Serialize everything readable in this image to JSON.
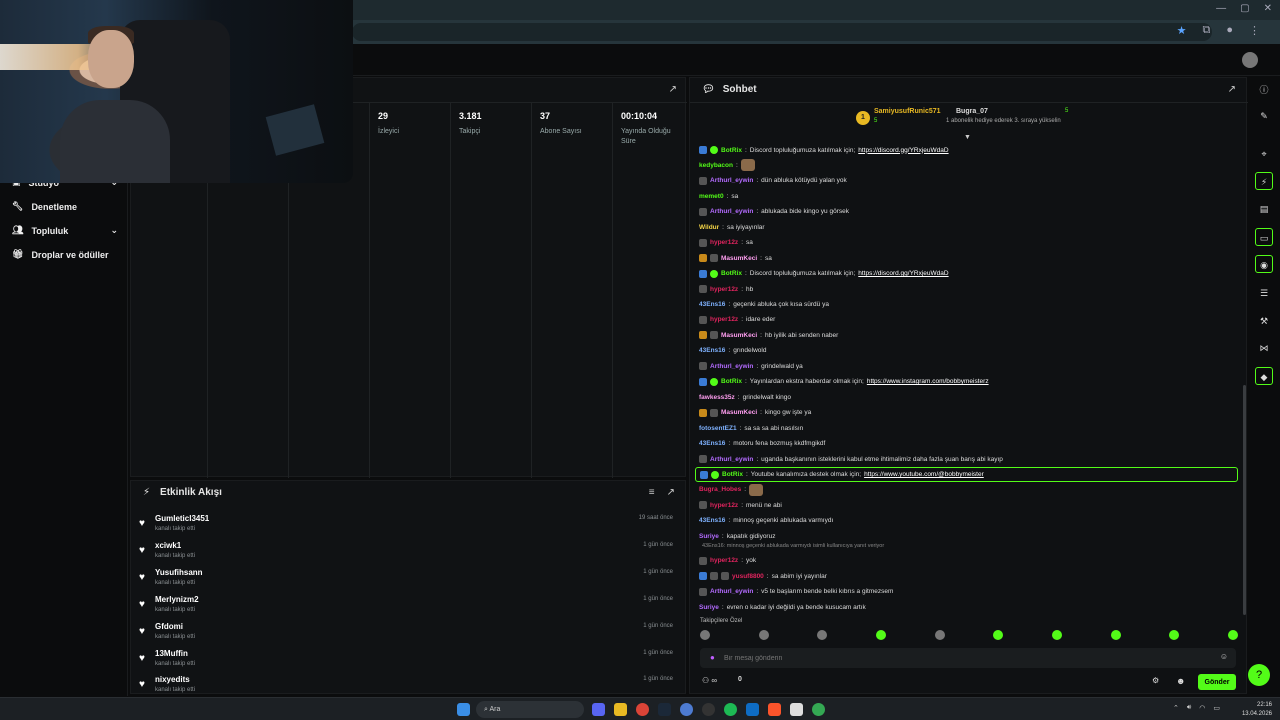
{
  "sidebar": {
    "items": [
      {
        "label": "Stüdyo",
        "icon": "studio-icon"
      },
      {
        "label": "Denetleme",
        "icon": "wrench-icon"
      },
      {
        "label": "Topluluk",
        "icon": "people-icon"
      },
      {
        "label": "Droplar ve ödüller",
        "icon": "gift-icon"
      }
    ]
  },
  "stats": [
    {
      "value": "29",
      "label": "İzleyici"
    },
    {
      "value": "3.181",
      "label": "Takipçi"
    },
    {
      "value": "37",
      "label": "Abone Sayısı"
    },
    {
      "value": "00:10:04",
      "label": "Yayında Olduğu Süre"
    }
  ],
  "feed": {
    "title": "Etkinlik Akışı",
    "items": [
      {
        "name": "Gumleticl3451",
        "sub": "kanalı takip etti",
        "time": "19 saat önce"
      },
      {
        "name": "xciwk1",
        "sub": "kanalı takip etti",
        "time": "1 gün önce"
      },
      {
        "name": "Yusufihsann",
        "sub": "kanalı takip etti",
        "time": "1 gün önce"
      },
      {
        "name": "Merlynizm2",
        "sub": "kanalı takip etti",
        "time": "1 gün önce"
      },
      {
        "name": "Gfdomi",
        "sub": "kanalı takip etti",
        "time": "1 gün önce"
      },
      {
        "name": "13Muffin",
        "sub": "kanalı takip etti",
        "time": "1 gün önce"
      },
      {
        "name": "nixyedits",
        "sub": "kanalı takip etti",
        "time": "1 gün önce"
      }
    ]
  },
  "chat": {
    "title": "Sohbet",
    "gifter1": {
      "rank": "1",
      "name": "SamiyusufRunic571",
      "count": "5"
    },
    "gifter2": {
      "name": "Bugra_07",
      "count": "5",
      "note": "1 abonelik hediye ederek 3. sıraya yükselin"
    },
    "messages": [
      {
        "user": "BotRix",
        "color": "#53fc18",
        "badges": [
          "bot",
          "ver"
        ],
        "text": "Discord topluluğumuza katılmak için;",
        "link": "https://discord.gg/YRxjeuWdaD"
      },
      {
        "user": "kedybacon",
        "color": "#53fc18",
        "badges": [],
        "sticker": true,
        "text": ""
      },
      {
        "user": "Arthurl_eywin",
        "color": "#b36bff",
        "badges": [
          "sub"
        ],
        "text": "dün abluka kötüydü yalan yok"
      },
      {
        "user": "memet0",
        "color": "#53fc18",
        "badges": [],
        "text": "sa"
      },
      {
        "user": "Arthurl_eywin",
        "color": "#b36bff",
        "badges": [
          "sub"
        ],
        "text": "ablukada bide kingo yu görsek"
      },
      {
        "user": "Wildur",
        "color": "#f5d547",
        "badges": [],
        "text": "sa iyiyayınlar"
      },
      {
        "user": "hyper12z",
        "color": "#e0245e",
        "badges": [
          "sub"
        ],
        "text": "sa"
      },
      {
        "user": "MasumKeci",
        "color": "#ff9ef0",
        "badges": [
          "crown",
          "sub"
        ],
        "text": "sa"
      },
      {
        "user": "BotRix",
        "color": "#53fc18",
        "badges": [
          "bot",
          "ver"
        ],
        "text": "Discord topluluğumuza katılmak için;",
        "link": "https://discord.gg/YRxjeuWdaD"
      },
      {
        "user": "hyper12z",
        "color": "#e0245e",
        "badges": [
          "sub"
        ],
        "text": "hb"
      },
      {
        "user": "43Ens16",
        "color": "#7fb2ff",
        "badges": [],
        "text": "geçenki abluka çok kısa sürdü ya"
      },
      {
        "user": "hyper12z",
        "color": "#e0245e",
        "badges": [
          "sub"
        ],
        "text": "idare eder"
      },
      {
        "user": "MasumKeci",
        "color": "#ff9ef0",
        "badges": [
          "crown",
          "sub"
        ],
        "text": "hb iyilik abi senden naber"
      },
      {
        "user": "43Ens16",
        "color": "#7fb2ff",
        "badges": [],
        "text": "grındelwold"
      },
      {
        "user": "Arthurl_eywin",
        "color": "#b36bff",
        "badges": [
          "sub"
        ],
        "text": "grindelwald ya"
      },
      {
        "user": "BotRix",
        "color": "#53fc18",
        "badges": [
          "bot",
          "ver"
        ],
        "text": "Yayınlardan ekstra haberdar olmak için;",
        "link": "https://www.instagram.com/bobbymeisterz"
      },
      {
        "user": "fawkess35z",
        "color": "#ff9ef0",
        "badges": [],
        "text": "grindelwalt kingo"
      },
      {
        "user": "MasumKeci",
        "color": "#ff9ef0",
        "badges": [
          "crown",
          "sub"
        ],
        "text": "kingo gw işte ya"
      },
      {
        "user": "fotosentEZ1",
        "color": "#7fb2ff",
        "badges": [],
        "text": "sa sa sa abi nasılsın"
      },
      {
        "user": "43Ens16",
        "color": "#7fb2ff",
        "badges": [],
        "text": "motoru fena bozmuş kkdfmgikdf"
      },
      {
        "user": "Arthurl_eywin",
        "color": "#b36bff",
        "badges": [
          "sub"
        ],
        "text": "uganda başkanının isteklerini kabul etme ihtimalimiz daha fazla şuan barış abi kayıp"
      },
      {
        "user": "BotRix",
        "color": "#53fc18",
        "badges": [
          "bot",
          "ver"
        ],
        "text": "Youtube kanalımıza destek olmak için;",
        "link": "https://www.youtube.com/@bobbymeister",
        "highlight": true
      },
      {
        "user": "Bugra_Hobes",
        "color": "#e0245e",
        "badges": [],
        "sticker": true,
        "text": ""
      },
      {
        "user": "hyper12z",
        "color": "#e0245e",
        "badges": [
          "sub"
        ],
        "text": "menü ne abi"
      },
      {
        "user": "43Ens16",
        "color": "#7fb2ff",
        "badges": [],
        "text": "minnoş geçenki ablukada varmıydı"
      },
      {
        "user": "Suriye",
        "color": "#b36bff",
        "badges": [],
        "text": "kapatık gidiyoruz"
      },
      {
        "user": "hyper12z",
        "color": "#e0245e",
        "badges": [
          "sub"
        ],
        "text": "yok",
        "reply": "43Ens16: minnoş geçenki ablukada varmıydı isimli kullanıcıya yanıt veriyor"
      },
      {
        "user": "yusuf8800",
        "color": "#e0245e",
        "badges": [
          "bot",
          "sub",
          "sub"
        ],
        "text": "sa abim iyi yayınlar"
      },
      {
        "user": "Arthurl_eywin",
        "color": "#b36bff",
        "badges": [
          "sub"
        ],
        "text": "v5 te başlarım bende belki kıbrıs a gitmezsem"
      },
      {
        "user": "Suriye",
        "color": "#b36bff",
        "badges": [],
        "text": "evren o kadar iyi değildi ya bende kusucam artık"
      }
    ],
    "emote_label": "Takipçilere Özel",
    "input_placeholder": "Bir mesaj gönderin",
    "points": "0",
    "send_label": "Gönder"
  },
  "taskbar": {
    "search_label": "Ara",
    "time": "22:16",
    "date": "13.04.2026"
  },
  "colors": {
    "accent": "#53fc18",
    "bg": "#0b0c0d",
    "panel": "#101214"
  }
}
